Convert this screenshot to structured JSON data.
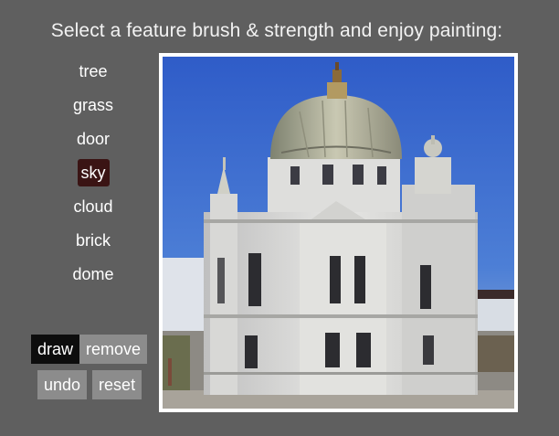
{
  "header": {
    "title": "Select a feature brush & strength and enjoy painting:"
  },
  "brushes": [
    {
      "label": "tree"
    },
    {
      "label": "grass"
    },
    {
      "label": "door"
    },
    {
      "label": "sky",
      "active": true
    },
    {
      "label": "cloud"
    },
    {
      "label": "brick"
    },
    {
      "label": "dome"
    }
  ],
  "controls": {
    "draw": "draw",
    "remove": "remove",
    "undo": "undo",
    "reset": "reset"
  },
  "colors": {
    "background": "#5f5f5f",
    "active_brush": "#3a1414",
    "mode_active": "#0d0d0d",
    "mode_inactive": "#8c8c8c"
  }
}
